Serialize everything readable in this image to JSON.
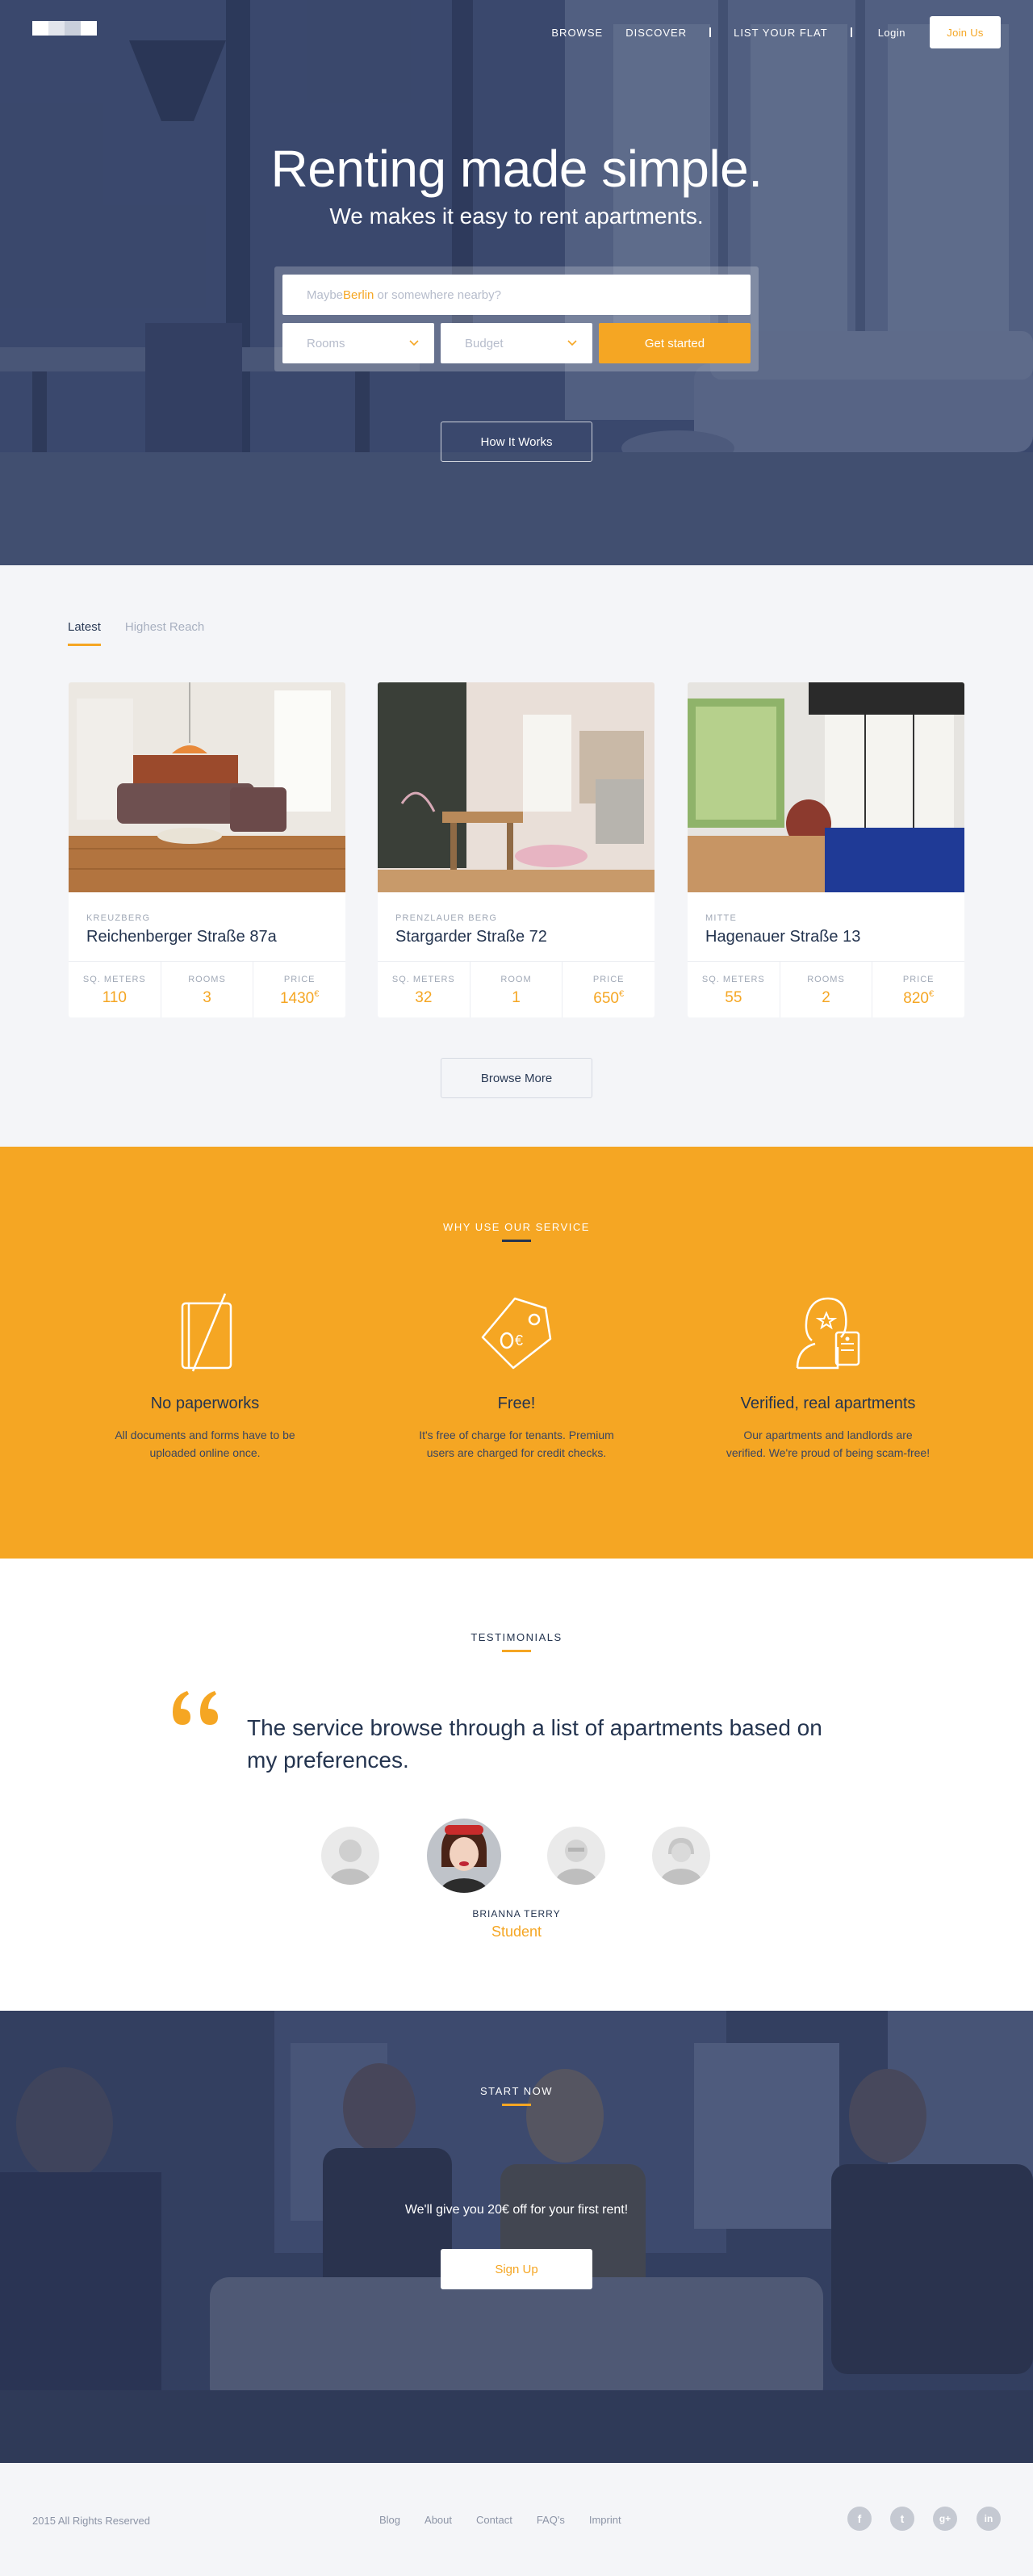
{
  "nav": {
    "browse": "BROWSE",
    "discover": "DISCOVER",
    "list_flat": "LIST YOUR FLAT",
    "login": "Login",
    "join": "Join Us"
  },
  "hero": {
    "title": "Renting made simple.",
    "subtitle": "We makes it easy to rent apartments.",
    "search_prefix": "Maybe ",
    "search_highlight": "Berlin",
    "search_suffix": " or somewhere nearby?",
    "rooms_select": "Rooms",
    "budget_select": "Budget",
    "cta": "Get started",
    "how": "How It Works"
  },
  "listings": {
    "tabs": [
      "Latest",
      "Highest Reach"
    ],
    "cards": [
      {
        "district": "KREUZBERG",
        "street": "Reichenberger Straße 87a",
        "stats": [
          {
            "label": "SQ. METERS",
            "value": "110"
          },
          {
            "label": "ROOMS",
            "value": "3"
          },
          {
            "label": "PRICE",
            "value": "1430",
            "unit": "€"
          }
        ]
      },
      {
        "district": "PRENZLAUER BERG",
        "street": "Stargarder Straße 72",
        "stats": [
          {
            "label": "SQ. METERS",
            "value": "32"
          },
          {
            "label": "ROOM",
            "value": "1"
          },
          {
            "label": "PRICE",
            "value": "650",
            "unit": "€"
          }
        ]
      },
      {
        "district": "MITTE",
        "street": "Hagenauer Straße 13",
        "stats": [
          {
            "label": "SQ. METERS",
            "value": "55"
          },
          {
            "label": "ROOMS",
            "value": "2"
          },
          {
            "label": "PRICE",
            "value": "820",
            "unit": "€"
          }
        ]
      }
    ],
    "browse_more": "Browse More"
  },
  "why": {
    "title": "WHY USE OUR SERVICE",
    "features": [
      {
        "icon": "paperwork-icon",
        "title": "No paperworks",
        "text": "All documents and forms have to be uploaded online once."
      },
      {
        "icon": "price-tag-icon",
        "title": "Free!",
        "text": "It's free of charge for tenants. Premium users are charged for credit checks."
      },
      {
        "icon": "verified-user-icon",
        "title": "Verified, real apartments",
        "text": "Our apartments and landlords are verified. We're proud of being scam-free!"
      }
    ]
  },
  "testimonials": {
    "title": "TESTIMONIALS",
    "quote": "The service browse through a list of apartments based on my preferences.",
    "person_name": "BRIANNA TERRY",
    "person_role": "Student"
  },
  "start": {
    "title": "START NOW",
    "offer": "We'll give you 20€ off for your first rent!",
    "signup": "Sign Up"
  },
  "footer": {
    "copyright": "2015 All Rights Reserved",
    "links": [
      "Blog",
      "About",
      "Contact",
      "FAQ's",
      "Imprint"
    ],
    "social": [
      "facebook-icon",
      "twitter-icon",
      "google-plus-icon",
      "linkedin-icon"
    ],
    "social_glyphs": [
      "f",
      "t",
      "g+",
      "in"
    ]
  },
  "colors": {
    "accent": "#f5a623",
    "dark": "#24344f",
    "overlay": "#2d3a5c"
  }
}
